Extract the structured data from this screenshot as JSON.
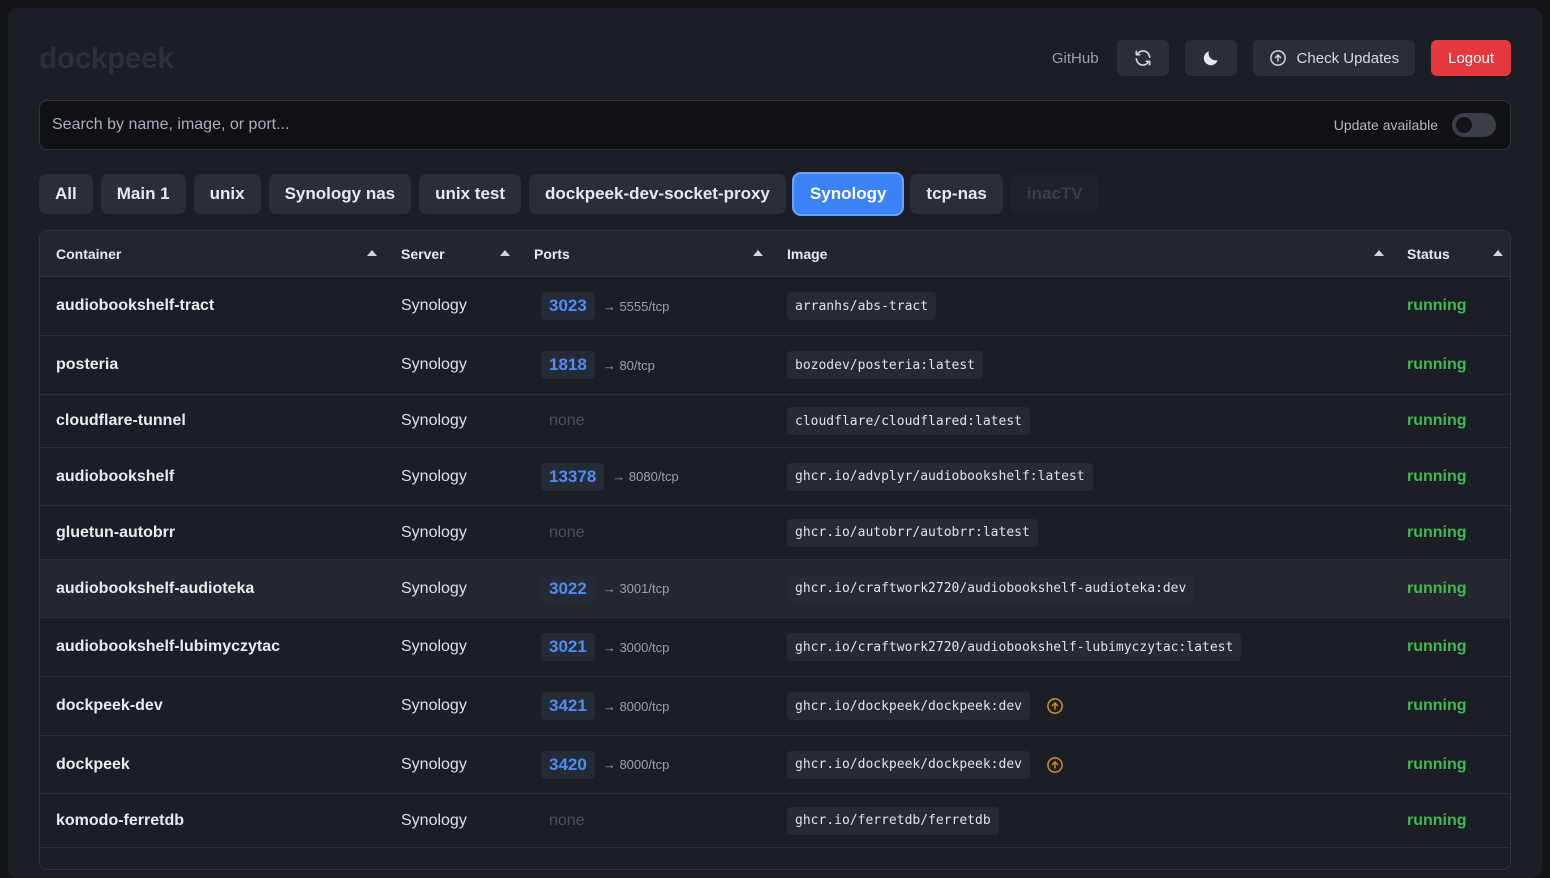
{
  "app": {
    "logo": "dockpeek"
  },
  "header": {
    "github_label": "GitHub",
    "refresh_icon": "refresh-icon",
    "theme_icon": "moon-icon",
    "check_updates_label": "Check Updates",
    "check_updates_icon": "arrow-up-circle-icon",
    "logout_label": "Logout"
  },
  "search": {
    "placeholder": "Search by name, image, or port...",
    "value": "",
    "update_filter_label": "Update available",
    "update_filter_on": false
  },
  "tabs": [
    {
      "label": "All"
    },
    {
      "label": "Main 1"
    },
    {
      "label": "unix"
    },
    {
      "label": "Synology nas"
    },
    {
      "label": "unix test"
    },
    {
      "label": "dockpeek-dev-socket-proxy"
    },
    {
      "label": "Synology",
      "active": true
    },
    {
      "label": "tcp-nas"
    },
    {
      "label": "inacTV",
      "disabled": true
    }
  ],
  "table": {
    "columns": [
      {
        "label": "Container"
      },
      {
        "label": "Server"
      },
      {
        "label": "Ports"
      },
      {
        "label": "Image"
      },
      {
        "label": "Status"
      }
    ],
    "status_color": "#3fb950",
    "update_icon_color": "#d8891e",
    "rows": [
      {
        "name": "audiobookshelf-tract",
        "server": "Synology",
        "port": "3023",
        "port_map": "→ 5555/tcp",
        "image": "arranhs/abs-tract",
        "status": "running",
        "update": false
      },
      {
        "name": "posteria",
        "server": "Synology",
        "port": "1818",
        "port_map": "→ 80/tcp",
        "image": "bozodev/posteria:latest",
        "status": "running",
        "update": false
      },
      {
        "name": "cloudflare-tunnel",
        "server": "Synology",
        "port": "",
        "port_none": "none",
        "image": "cloudflare/cloudflared:latest",
        "status": "running",
        "update": false
      },
      {
        "name": "audiobookshelf",
        "server": "Synology",
        "port": "13378",
        "port_map": "→ 8080/tcp",
        "image": "ghcr.io/advplyr/audiobookshelf:latest",
        "status": "running",
        "update": false
      },
      {
        "name": "gluetun-autobrr",
        "server": "Synology",
        "port": "",
        "port_none": "none",
        "image": "ghcr.io/autobrr/autobrr:latest",
        "status": "running",
        "update": false
      },
      {
        "name": "audiobookshelf-audioteka",
        "server": "Synology",
        "port": "3022",
        "port_map": "→ 3001/tcp",
        "image": "ghcr.io/craftwork2720/audiobookshelf-audioteka:dev",
        "status": "running",
        "update": false,
        "hover": true
      },
      {
        "name": "audiobookshelf-lubimyczytac",
        "server": "Synology",
        "port": "3021",
        "port_map": "→ 3000/tcp",
        "image": "ghcr.io/craftwork2720/audiobookshelf-lubimyczytac:latest",
        "status": "running",
        "update": false
      },
      {
        "name": "dockpeek-dev",
        "server": "Synology",
        "port": "3421",
        "port_map": "→ 8000/tcp",
        "image": "ghcr.io/dockpeek/dockpeek:dev",
        "status": "running",
        "update": true
      },
      {
        "name": "dockpeek",
        "server": "Synology",
        "port": "3420",
        "port_map": "→ 8000/tcp",
        "image": "ghcr.io/dockpeek/dockpeek:dev",
        "status": "running",
        "update": true
      },
      {
        "name": "komodo-ferretdb",
        "server": "Synology",
        "port": "",
        "port_none": "none",
        "image": "ghcr.io/ferretdb/ferretdb",
        "status": "running",
        "update": false
      }
    ]
  }
}
